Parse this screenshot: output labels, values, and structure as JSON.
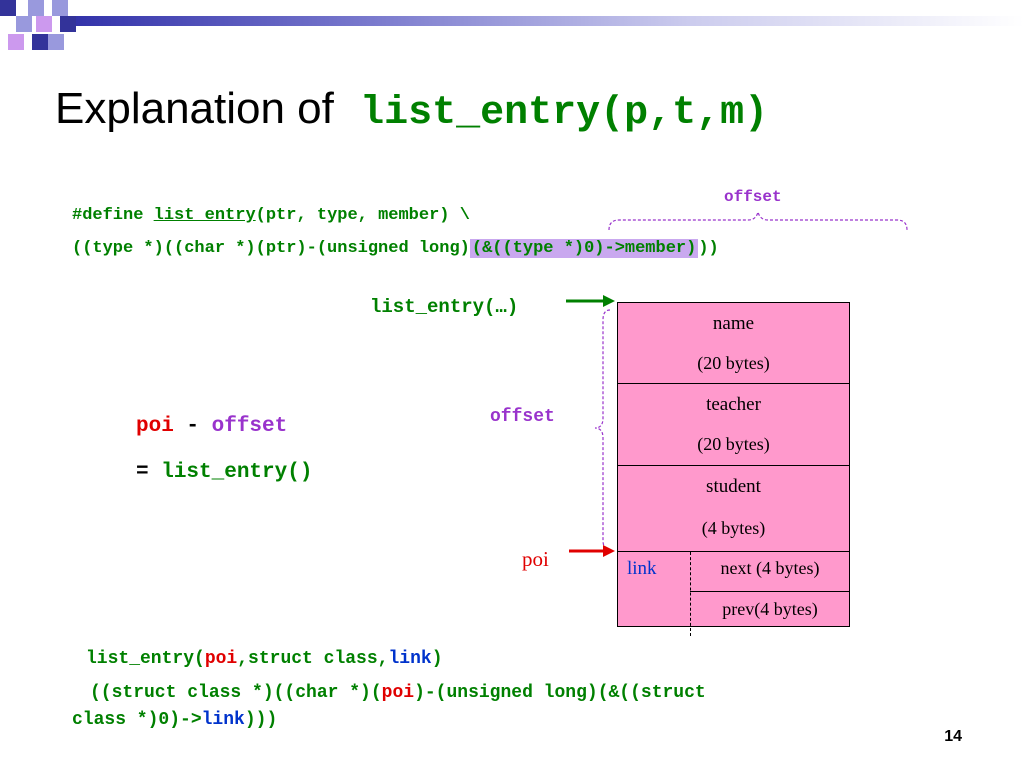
{
  "slide": {
    "title_prefix": "Explanation of",
    "title_code": "list_entry(p,t,m)",
    "page_number": "14"
  },
  "define": {
    "line1_pre": "#define ",
    "line1_macro": "list_entry",
    "line1_post": "(ptr, type, member) \\",
    "line2_pre": "((type *)((char *)(ptr)-(unsigned long)",
    "line2_highlight": "(&((type *)0)->member)",
    "line2_post": "))",
    "offset_label": "offset"
  },
  "diagram": {
    "list_entry_label": "list_entry(…)",
    "offset_label": "offset",
    "poi_label": "poi",
    "fields": {
      "name": "name",
      "name_size": "(20 bytes)",
      "teacher": "teacher",
      "teacher_size": "(20 bytes)",
      "student": "student",
      "student_size": "(4 bytes)",
      "link": "link",
      "next": "next (4 bytes)",
      "prev": "prev(4 bytes)"
    }
  },
  "formula": {
    "poi": "poi",
    "minus": " - ",
    "offset": "offset",
    "equals": "= ",
    "result": "list_entry()"
  },
  "example": {
    "l1_a": "list_entry(",
    "l1_poi": "poi",
    "l1_b": ",struct class,",
    "l1_link": "link",
    "l1_c": ")",
    "l2_a": "((struct class *)((char *)(",
    "l2_poi": "poi",
    "l2_b": ")-(unsigned long)(&((struct",
    "l3_a": "class *)0)->",
    "l3_link": "link",
    "l3_b": ")))"
  },
  "colors": {
    "code_green": "#008000",
    "poi_red": "#e00000",
    "offset_purple": "#9933cc",
    "link_blue": "#0033cc",
    "struct_fill": "#ff99cc",
    "highlight": "#c9a8ef"
  }
}
